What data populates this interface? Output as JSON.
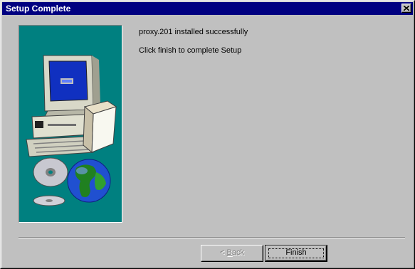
{
  "window": {
    "title": "Setup Complete"
  },
  "content": {
    "message_installed": "proxy.201 installed successfully",
    "message_instruction": "Click finish to complete Setup"
  },
  "buttons": {
    "back_prefix": "< ",
    "back_mnemonic": "B",
    "back_rest": "ack",
    "finish_label": "Finish"
  },
  "graphic": {
    "background_color": "#008080",
    "icons": [
      "computer-icon",
      "cd-icon",
      "globe-icon"
    ]
  },
  "colors": {
    "titlebar": "#000080",
    "dialog": "#c0c0c0"
  }
}
